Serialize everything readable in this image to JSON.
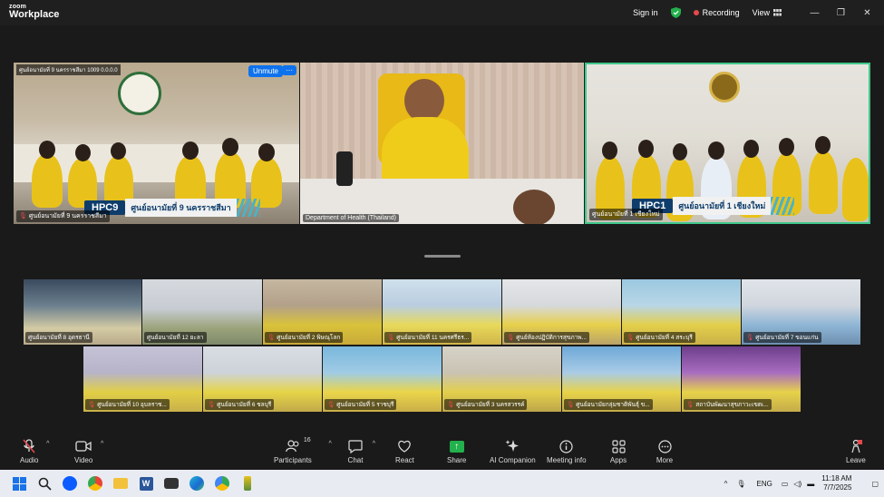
{
  "titlebar": {
    "logo_line1": "zoom",
    "logo_line2": "Workplace",
    "sign_in": "Sign in",
    "recording": "Recording",
    "view": "View",
    "minimize": "—",
    "restore": "❐",
    "close": "✕"
  },
  "speakers": [
    {
      "name": "ศูนย์อนามัยที่ 9 นครราชสีมา",
      "top_info": "ศูนย์อนามัยที่ 9 นครราชสีมา   1009   0.0.0.0",
      "hpc_tag": "HPC9",
      "hpc_text": "ศูนย์อนามัยที่ 9 นครราชสีมา",
      "unmute_label": "Unmute",
      "more_label": "···"
    },
    {
      "name": "Department of Health (Thailand)"
    },
    {
      "name": "ศูนย์อนามัยที่ 1 เชียงใหม่",
      "hpc_tag": "HPC1",
      "hpc_text": "ศูนย์อนามัยที่ 1 เชียงใหม่"
    }
  ],
  "gallery_row1": [
    {
      "name": "ศูนย์อนามัยที่ 8 อุดรธานี"
    },
    {
      "name": "ศูนย์อนามัยที่ 12 ยะลา"
    },
    {
      "name": "ศูนย์อนามัยที่ 2 พิษณุโลก"
    },
    {
      "name": "ศูนย์อนามัยที่ 11 นครศรีธร..."
    },
    {
      "name": "ศูนย์ห้องปฏิบัติการสุขภาพ..."
    },
    {
      "name": "ศูนย์อนามัยที่ 4 สระบุรี"
    },
    {
      "name": "ศูนย์อนามัยที่ 7 ขอนแก่น"
    }
  ],
  "gallery_row2": [
    {
      "name": "ศูนย์อนามัยที่ 10 อุบลราช..."
    },
    {
      "name": "ศูนย์อนามัยที่ 6 ชลบุรี"
    },
    {
      "name": "ศูนย์อนามัยที่ 5 ราชบุรี"
    },
    {
      "name": "ศูนย์อนามัยที่ 3 นครสวรรค์"
    },
    {
      "name": "ศูนย์อนามัยกลุ่มชาติพันธุ์ ข..."
    },
    {
      "name": "สถาบันพัฒนาสุขภาวะเขตเ..."
    }
  ],
  "toolbar": {
    "audio": "Audio",
    "video": "Video",
    "participants": "Participants",
    "participants_count": "16",
    "chat": "Chat",
    "react": "React",
    "share": "Share",
    "ai_companion": "AI Companion",
    "meeting_info": "Meeting info",
    "apps": "Apps",
    "more": "More",
    "leave": "Leave"
  },
  "taskbar": {
    "lang": "ENG",
    "time": "11:18 AM",
    "date": "7/7/2025"
  },
  "colors": {
    "active_border": "#3ec78b",
    "accent_blue": "#0e72ed",
    "record_red": "#e5484d",
    "share_green": "#22b14c"
  }
}
